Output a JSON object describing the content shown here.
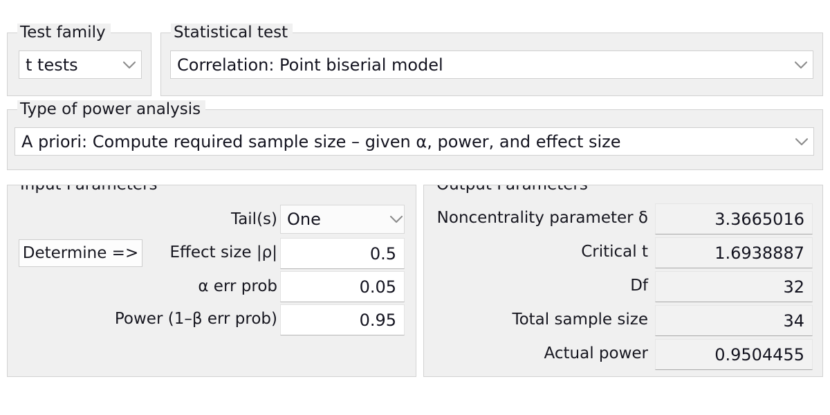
{
  "test_family": {
    "legend": "Test family",
    "selected": "t tests",
    "chevron": "chevron-down-icon"
  },
  "statistical_test": {
    "legend": "Statistical test",
    "selected": "Correlation: Point biserial model",
    "chevron": "chevron-down-icon"
  },
  "power_analysis": {
    "legend": "Type of power analysis",
    "selected": "A priori: Compute required sample size – given α, power, and effect size",
    "chevron": "chevron-down-icon"
  },
  "input_parameters": {
    "legend": "Input Parameters",
    "determine_button": "Determine =>",
    "rows": [
      {
        "label": "Tail(s)",
        "value": "One",
        "kind": "combo"
      },
      {
        "label": "Effect size |ρ|",
        "value": "0.5",
        "kind": "input"
      },
      {
        "label": "α err prob",
        "value": "0.05",
        "kind": "input"
      },
      {
        "label": "Power (1–β err prob)",
        "value": "0.95",
        "kind": "input"
      }
    ]
  },
  "output_parameters": {
    "legend": "Output Parameters",
    "rows": [
      {
        "label": "Noncentrality parameter δ",
        "value": "3.3665016"
      },
      {
        "label": "Critical t",
        "value": "1.6938887"
      },
      {
        "label": "Df",
        "value": "32"
      },
      {
        "label": "Total sample size",
        "value": "34"
      },
      {
        "label": "Actual power",
        "value": "0.9504455"
      }
    ]
  },
  "colors": {
    "panel_background": "#f0f0f0",
    "panel_border": "#d2d2d2",
    "input_field_background": "#ffffff",
    "output_field_background": "#f2f2f2",
    "text": "#16161f"
  }
}
